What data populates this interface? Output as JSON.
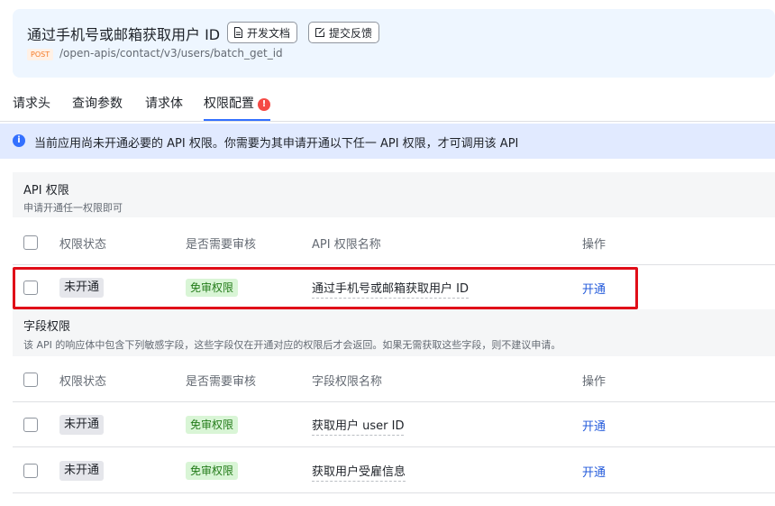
{
  "header": {
    "title": "通过手机号或邮箱获取用户 ID",
    "docs_button": "开发文档",
    "feedback_button": "提交反馈",
    "method": "POST",
    "path": "/open-apis/contact/v3/users/batch_get_id"
  },
  "tabs": [
    {
      "label": "请求头"
    },
    {
      "label": "查询参数"
    },
    {
      "label": "请求体"
    },
    {
      "label": "权限配置",
      "badge": "!"
    }
  ],
  "notice": {
    "icon": "info-icon",
    "text": "当前应用尚未开通必要的 API 权限。你需要为其申请开通以下任一 API 权限，才可调用该 API"
  },
  "api_section": {
    "title": "API 权限",
    "subtitle": "申请开通任一权限即可",
    "columns": [
      "权限状态",
      "是否需要审核",
      "API 权限名称",
      "操作"
    ],
    "rows": [
      {
        "status": "未开通",
        "review": "免审权限",
        "name": "通过手机号或邮箱获取用户 ID",
        "action": "开通"
      }
    ]
  },
  "field_section": {
    "title": "字段权限",
    "subtitle": "该 API 的响应体中包含下列敏感字段，这些字段仅在开通对应的权限后才会返回。如果无需获取这些字段，则不建议申请。",
    "columns": [
      "权限状态",
      "是否需要审核",
      "字段权限名称",
      "操作"
    ],
    "rows": [
      {
        "status": "未开通",
        "review": "免审权限",
        "name": "获取用户 user ID",
        "action": "开通"
      },
      {
        "status": "未开通",
        "review": "免审权限",
        "name": "获取用户受雇信息",
        "action": "开通"
      }
    ]
  },
  "colors": {
    "accent": "#3370ff",
    "link": "#245bdb",
    "highlight": "#e00d18",
    "tag_green_bg": "#d9f5d6",
    "tag_green_text": "#237b19"
  }
}
